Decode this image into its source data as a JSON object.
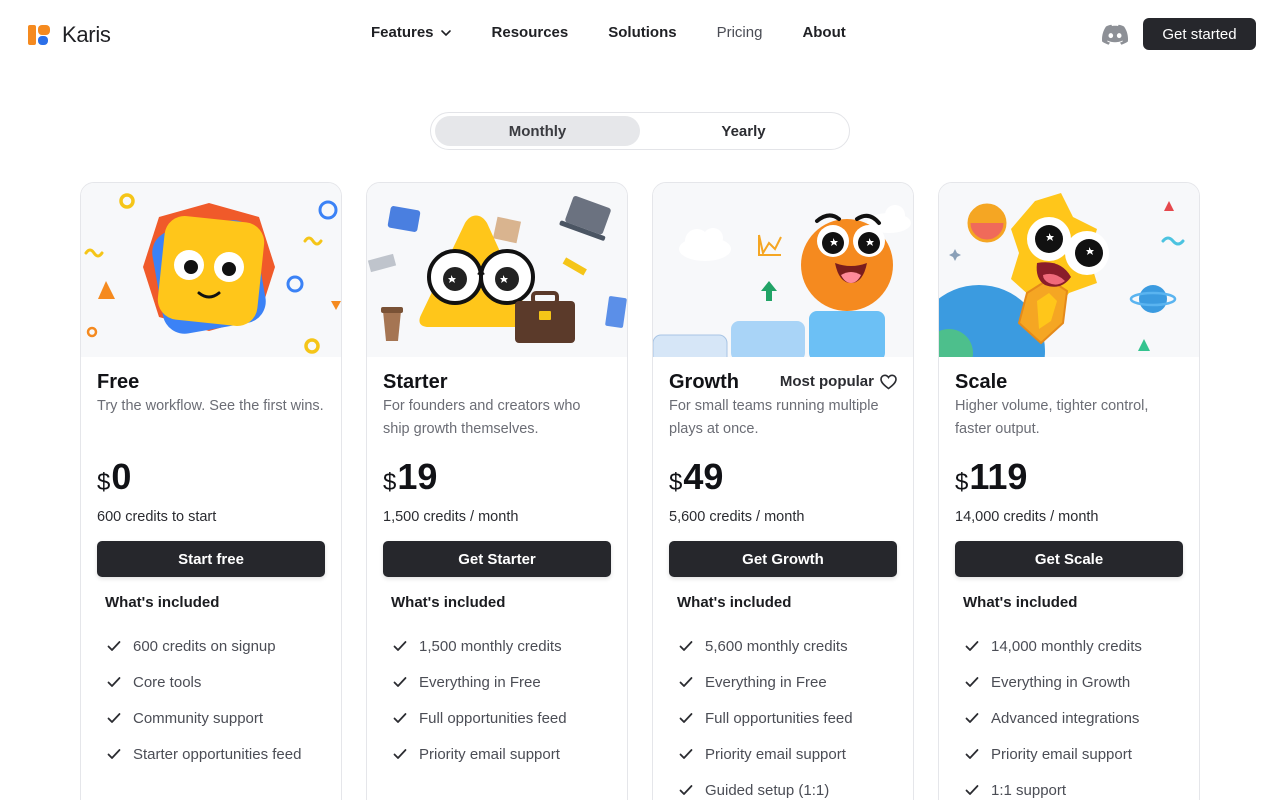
{
  "brand": {
    "name": "Karis"
  },
  "nav": {
    "items": [
      {
        "label": "Features",
        "has_dropdown": true
      },
      {
        "label": "Resources",
        "has_dropdown": false
      },
      {
        "label": "Solutions",
        "has_dropdown": false
      },
      {
        "label": "Pricing",
        "has_dropdown": false
      },
      {
        "label": "About",
        "has_dropdown": false
      }
    ],
    "discord_icon": "discord-icon",
    "cta_label": "Get started"
  },
  "billing_toggle": {
    "options": [
      "Monthly",
      "Yearly"
    ],
    "selected": "Monthly"
  },
  "plans": [
    {
      "name": "Free",
      "description": "Try the workflow. See the first wins.",
      "currency": "$",
      "price": "0",
      "credits": "600 credits to start",
      "button_label": "Start free",
      "included_title": "What's included",
      "features": [
        "600 credits on signup",
        "Core tools",
        "Community support",
        "Starter opportunities feed"
      ]
    },
    {
      "name": "Starter",
      "description": "For founders and creators who ship growth themselves.",
      "currency": "$",
      "price": "19",
      "credits": "1,500 credits / month",
      "button_label": "Get Starter",
      "included_title": "What's included",
      "features": [
        "1,500 monthly credits",
        "Everything in Free",
        "Full opportunities feed",
        "Priority email support"
      ]
    },
    {
      "name": "Growth",
      "badge": "Most popular",
      "description": "For small teams running multiple plays at once.",
      "currency": "$",
      "price": "49",
      "credits": "5,600 credits / month",
      "button_label": "Get Growth",
      "included_title": "What's included",
      "features": [
        "5,600 monthly credits",
        "Everything in Free",
        "Full opportunities feed",
        "Priority email support",
        "Guided setup (1:1)"
      ]
    },
    {
      "name": "Scale",
      "description": "Higher volume, tighter control, faster output.",
      "currency": "$",
      "price": "119",
      "credits": "14,000 credits / month",
      "button_label": "Get Scale",
      "included_title": "What's included",
      "features": [
        "14,000 monthly credits",
        "Everything in Growth",
        "Advanced integrations",
        "Priority email support",
        "1:1 support"
      ]
    }
  ],
  "colors": {
    "button": "#26272c",
    "brand_orange": "#f58a1f",
    "brand_blue": "#2b6fe8"
  }
}
